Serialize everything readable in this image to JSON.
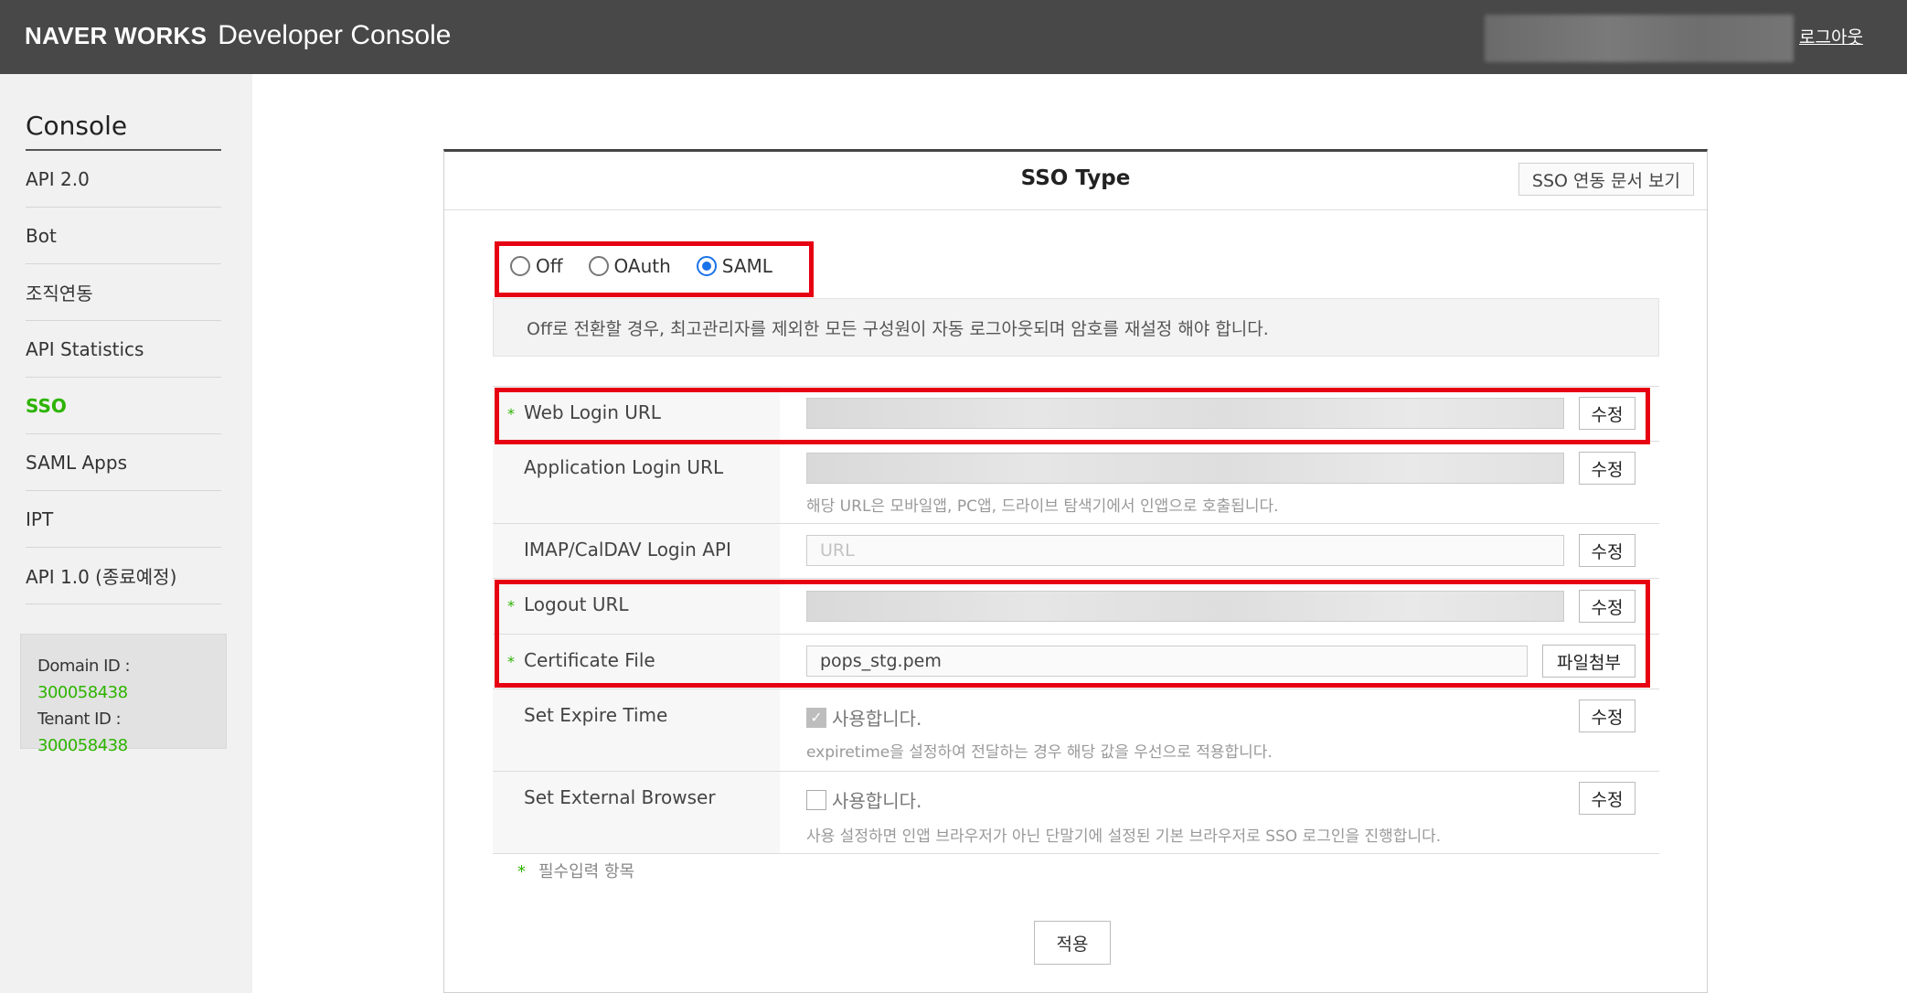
{
  "header": {
    "brand": "NAVER WORKS",
    "product": "Developer Console",
    "logout_label": "로그아웃"
  },
  "sidebar": {
    "title": "Console",
    "items": [
      {
        "label": "API 2.0"
      },
      {
        "label": "Bot"
      },
      {
        "label": "조직연동"
      },
      {
        "label": "API Statistics"
      },
      {
        "label": "SSO",
        "active": true
      },
      {
        "label": "SAML Apps"
      },
      {
        "label": "IPT"
      },
      {
        "label": "API 1.0 (종료예정)"
      }
    ],
    "domain_label": "Domain ID :",
    "domain_id": "300058438",
    "tenant_label": "Tenant ID : ",
    "tenant_id": "300058438"
  },
  "panel": {
    "title": "SSO Type",
    "doc_button": "SSO 연동 문서 보기",
    "radio_options": [
      {
        "label": "Off",
        "selected": false
      },
      {
        "label": "OAuth",
        "selected": false
      },
      {
        "label": "SAML",
        "selected": true
      }
    ],
    "notice": "Off로 전환할 경우, 최고관리자를 제외한 모든 구성원이 자동 로그아웃되며 암호를 재설정 해야 합니다.",
    "rows": {
      "web_login": {
        "label": "Web Login URL",
        "required": true,
        "value": "",
        "button": "수정"
      },
      "app_login": {
        "label": "Application Login URL",
        "required": false,
        "value": "",
        "button": "수정",
        "hint": "해당 URL은 모바일앱, PC앱, 드라이브 탐색기에서 인앱으로 호출됩니다."
      },
      "imap": {
        "label": "IMAP/CalDAV Login API",
        "required": false,
        "placeholder": "URL",
        "button": "수정"
      },
      "logout": {
        "label": "Logout URL",
        "required": true,
        "value": "",
        "button": "수정"
      },
      "certificate": {
        "label": "Certificate File",
        "required": true,
        "value": "pops_stg.pem",
        "button": "파일첨부"
      },
      "expire": {
        "label": "Set Expire Time",
        "checkbox_label": "사용합니다.",
        "checked": true,
        "button": "수정",
        "hint": "expiretime을 설정하여 전달하는 경우 해당 값을 우선으로 적용합니다."
      },
      "browser": {
        "label": "Set External Browser",
        "checkbox_label": "사용합니다.",
        "checked": false,
        "button": "수정",
        "hint": "사용 설정하면 인앱 브라우저가 아닌 단말기에 설정된 기본 브라우저로 SSO 로그인을 진행합니다."
      }
    },
    "required_note": "필수입력 항목",
    "required_mark": "*",
    "apply_button": "적용"
  },
  "colors": {
    "accent_green": "#2db400",
    "highlight_red": "#e60012",
    "header_bg": "#484848"
  }
}
